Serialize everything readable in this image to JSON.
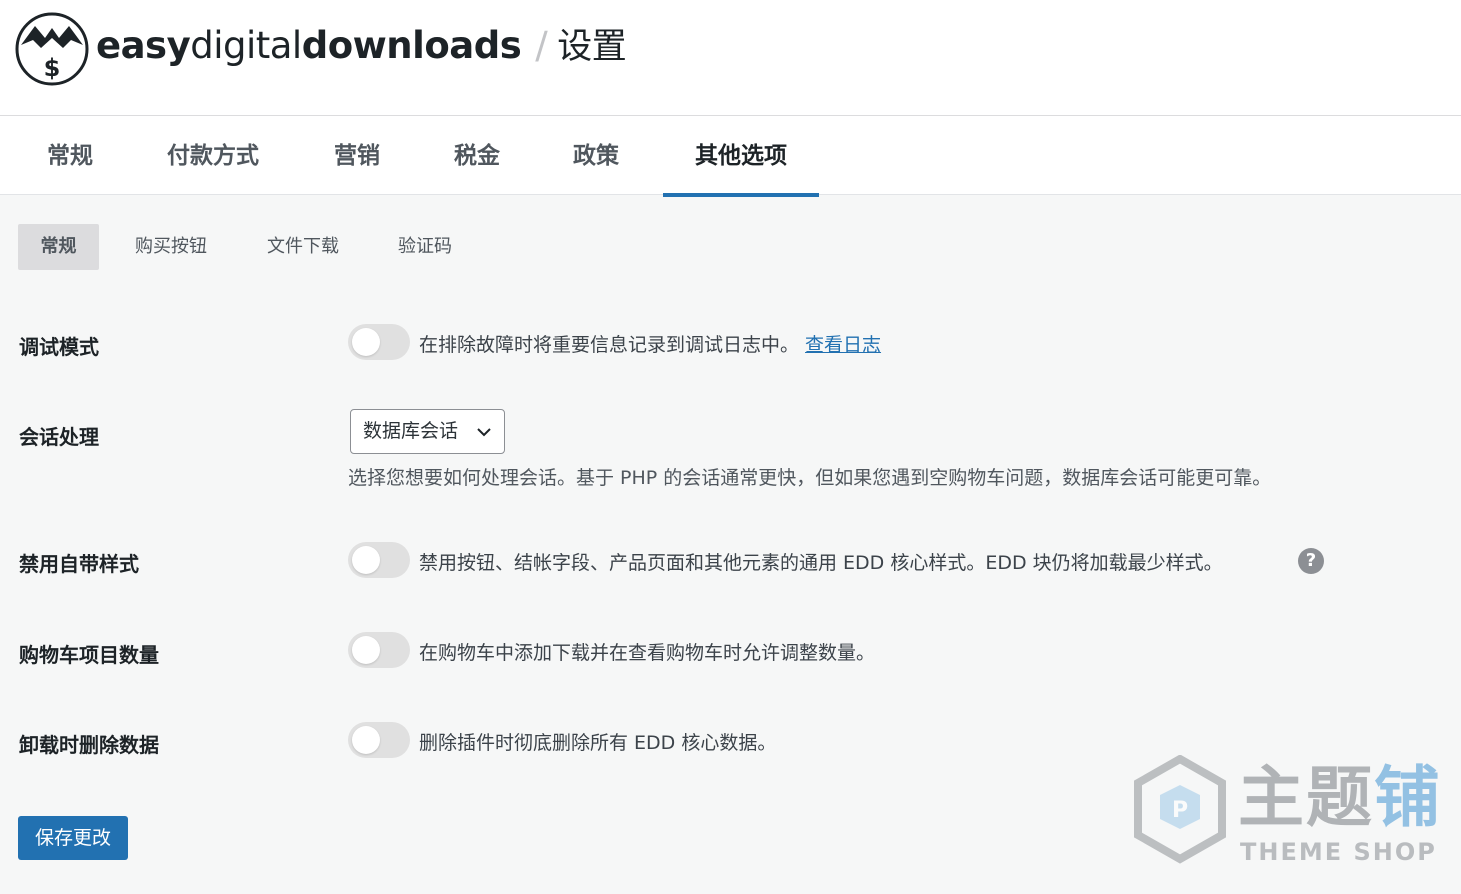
{
  "header": {
    "brand_bold": "easy",
    "brand_light": "digital",
    "brand_bold2": "downloads",
    "separator": "/",
    "page_title": "设置"
  },
  "tabs": [
    {
      "label": "常规"
    },
    {
      "label": "付款方式"
    },
    {
      "label": "营销"
    },
    {
      "label": "税金"
    },
    {
      "label": "政策"
    },
    {
      "label": "其他选项"
    }
  ],
  "active_tab": "其他选项",
  "subtabs": [
    {
      "label": "常规"
    },
    {
      "label": "购买按钮"
    },
    {
      "label": "文件下载"
    },
    {
      "label": "验证码"
    }
  ],
  "active_subtab": "常规",
  "settings": {
    "debug": {
      "label": "调试模式",
      "enabled": false,
      "description": "在排除故障时将重要信息记录到调试日志中。",
      "link": "查看日志"
    },
    "session": {
      "label": "会话处理",
      "selected": "数据库会话",
      "description": "选择您想要如何处理会话。基于 PHP 的会话通常更快，但如果您遇到空购物车问题，数据库会话可能更可靠。"
    },
    "disable_styles": {
      "label": "禁用自带样式",
      "enabled": false,
      "description": "禁用按钮、结帐字段、产品页面和其他元素的通用 EDD 核心样式。EDD 块仍将加载最少样式。",
      "help": "?"
    },
    "cart_quantity": {
      "label": "购物车项目数量",
      "enabled": false,
      "description": "在购物车中添加下载并在查看购物车时允许调整数量。"
    },
    "uninstall": {
      "label": "卸载时删除数据",
      "enabled": false,
      "description": "删除插件时彻底删除所有 EDD 核心数据。"
    }
  },
  "save_button": "保存更改",
  "watermark": {
    "title_gray": "主题",
    "title_blue": "铺",
    "subtitle": "THEME SHOP"
  },
  "colors": {
    "accent": "#2271b1",
    "toggle_off": "#e0e0e0",
    "background": "#f6f7f7"
  }
}
